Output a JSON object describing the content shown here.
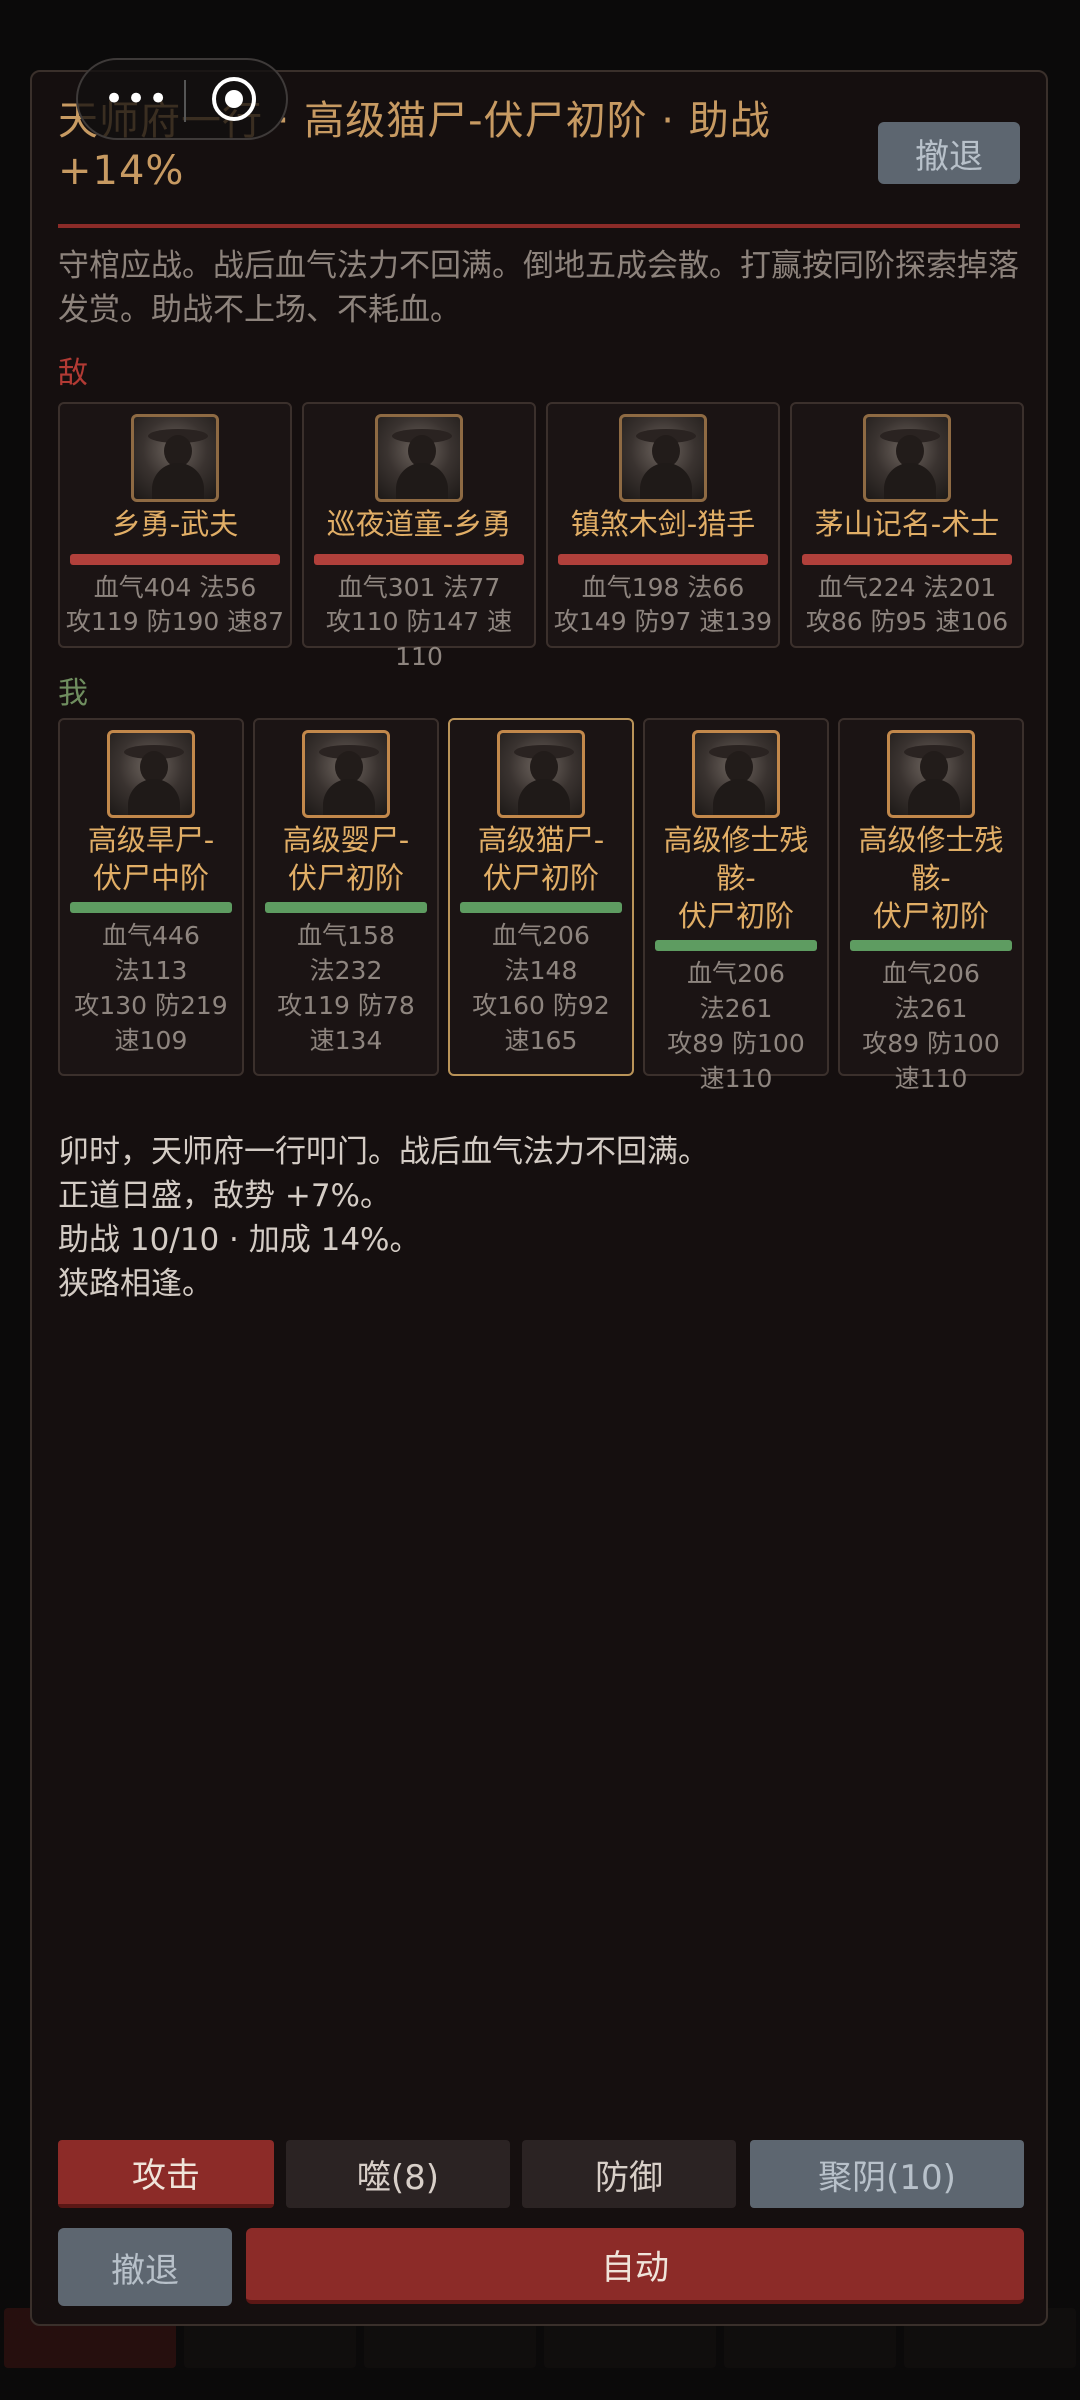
{
  "battle": {
    "title": "天师府一行 · 高级猫尸-伏尸初阶 · 助战+14%",
    "retreat_top": "撤退",
    "description": "守棺应战。战后血气法力不回满。倒地五成会散。打赢按同阶探索掉落发赏。助战不上场、不耗血。",
    "enemy_label": "敌",
    "ally_label": "我"
  },
  "capsule": {
    "more": "•••"
  },
  "enemies": [
    {
      "name": "乡勇-武夫",
      "stats1": "血气404 法56",
      "stats2": "攻119 防190 速87",
      "hp_fraction": 1.0
    },
    {
      "name": "巡夜道童-乡勇",
      "stats1": "血气301 法77",
      "stats2": "攻110 防147 速110",
      "hp_fraction": 1.0
    },
    {
      "name": "镇煞木剑-猎手",
      "stats1": "血气198 法66",
      "stats2": "攻149 防97 速139",
      "hp_fraction": 1.0
    },
    {
      "name": "茅山记名-术士",
      "stats1": "血气224 法201",
      "stats2": "攻86 防95 速106",
      "hp_fraction": 1.0
    }
  ],
  "allies": [
    {
      "name1": "高级旱尸-",
      "name2": "伏尸中阶",
      "s1": "血气446",
      "s2": "法113",
      "s3": "攻130 防219",
      "s4": "速109",
      "hp_fraction": 1.0,
      "active": false
    },
    {
      "name1": "高级婴尸-",
      "name2": "伏尸初阶",
      "s1": "血气158",
      "s2": "法232",
      "s3": "攻119 防78",
      "s4": "速134",
      "hp_fraction": 1.0,
      "active": false
    },
    {
      "name1": "高级猫尸-",
      "name2": "伏尸初阶",
      "s1": "血气206",
      "s2": "法148",
      "s3": "攻160 防92",
      "s4": "速165",
      "hp_fraction": 1.0,
      "active": true
    },
    {
      "name1": "高级修士残",
      "name1b": "骸-",
      "name2": "伏尸初阶",
      "s1": "血气206",
      "s2": "法261",
      "s3": "攻89 防100",
      "s4": "速110",
      "hp_fraction": 1.0,
      "active": false
    },
    {
      "name1": "高级修士残",
      "name1b": "骸-",
      "name2": "伏尸初阶",
      "s1": "血气206",
      "s2": "法261",
      "s3": "攻89 防100",
      "s4": "速110",
      "hp_fraction": 1.0,
      "active": false
    }
  ],
  "log": [
    "卯时，天师府一行叩门。战后血气法力不回满。",
    "正道日盛，敌势 +7%。",
    "助战 10/10 · 加成 14%。",
    "狭路相逢。"
  ],
  "actions": {
    "attack": "攻击",
    "devour": "噬(8)",
    "defend": "防御",
    "gather_yin": "聚阴(10)",
    "retreat": "撤退",
    "auto": "自动"
  },
  "colors": {
    "accent_red": "#8c2b28",
    "hp_enemy": "#b1403b",
    "hp_ally": "#5e9c61",
    "name_gold": "#e1ae66"
  }
}
